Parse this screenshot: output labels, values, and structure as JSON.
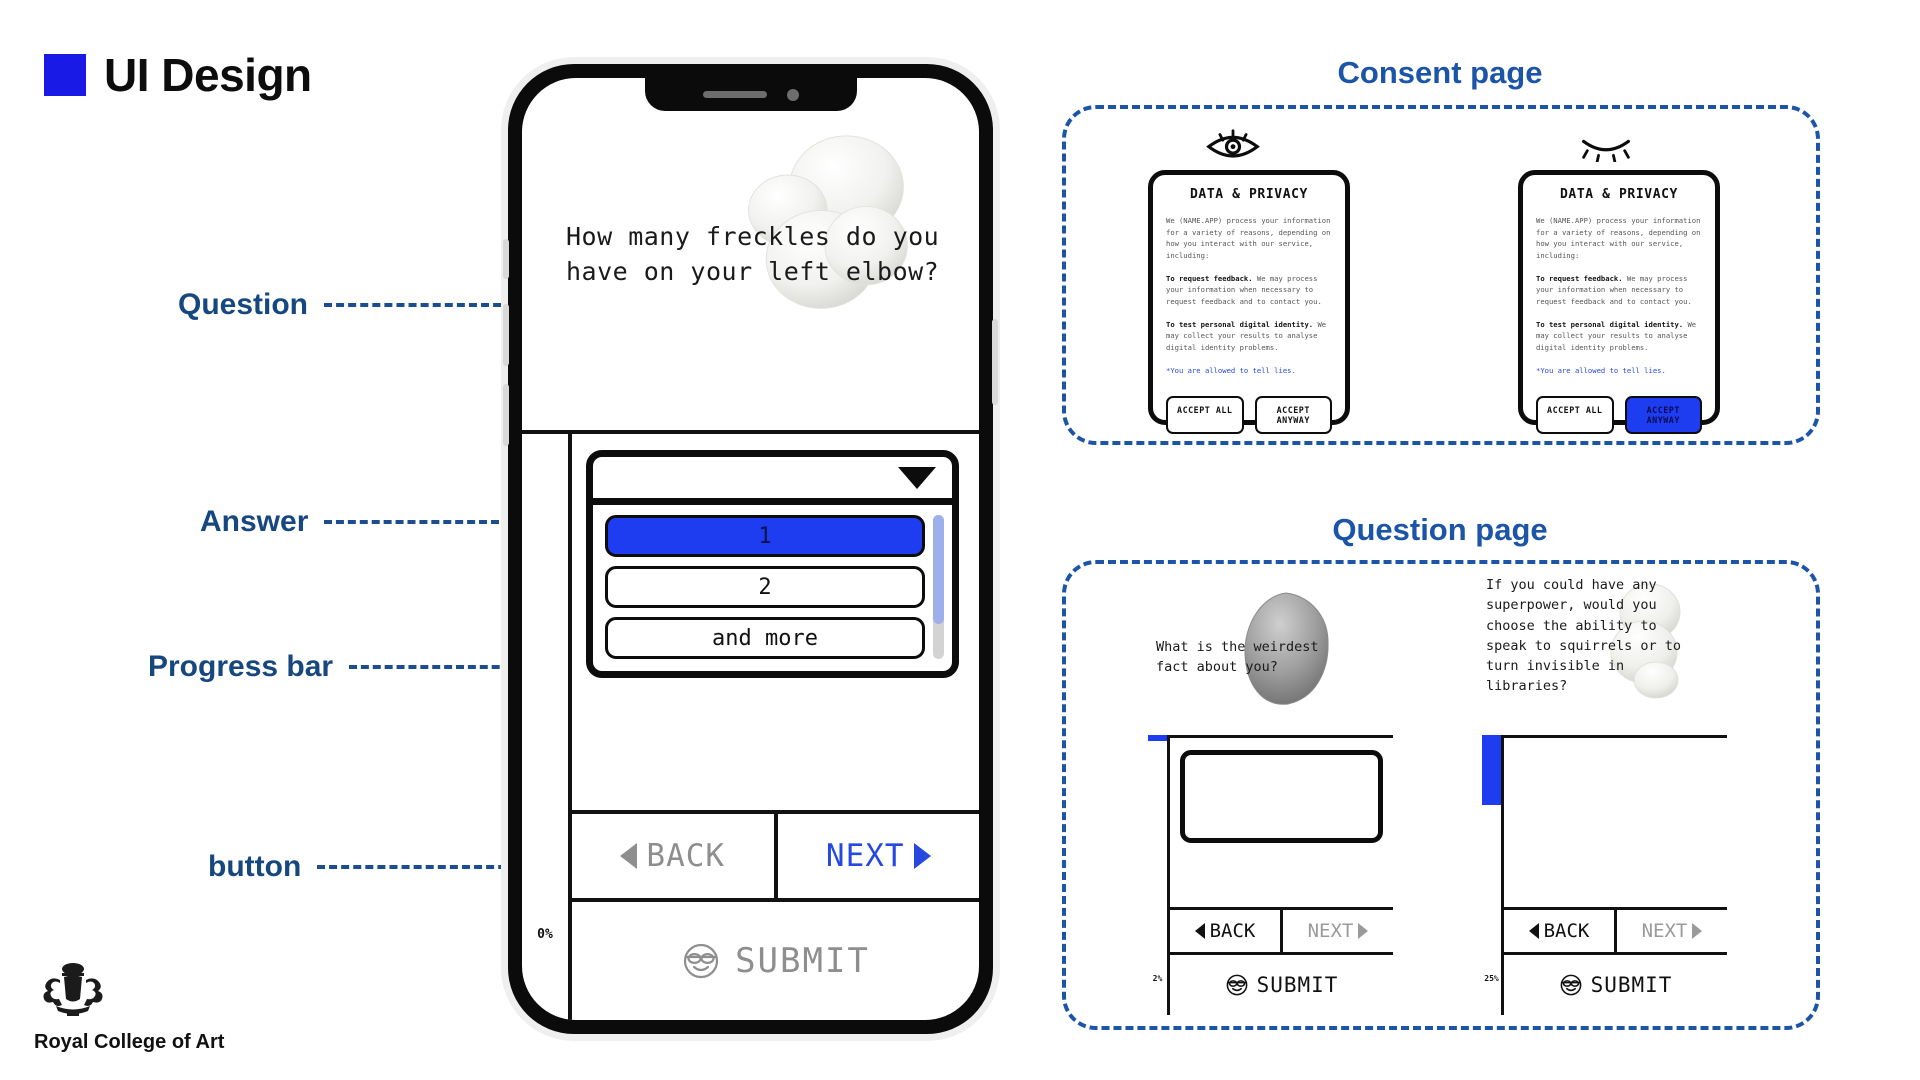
{
  "slide": {
    "title": "UI Design",
    "accent_blue": "#1a1ae6",
    "label_blue": "#16477e",
    "panel_blue": "#1c55a8"
  },
  "annotations": [
    {
      "label": "Question"
    },
    {
      "label": "Answer"
    },
    {
      "label": "Progress bar"
    },
    {
      "label": "button"
    }
  ],
  "phone": {
    "question_text": "How many freckles do you have on your left elbow?",
    "dropdown": {
      "selected": "",
      "options": [
        "1",
        "2",
        "and more"
      ],
      "highlighted_index": 0,
      "caret_icon": "chevron-down-icon"
    },
    "progress": {
      "percent_label": "0%",
      "percent_value": 0
    },
    "nav": {
      "back_label": "BACK",
      "next_label": "NEXT",
      "back_icon": "triangle-left-icon",
      "next_icon": "triangle-right-icon"
    },
    "submit": {
      "label": "SUBMIT",
      "icon": "sunglasses-smiley-icon"
    }
  },
  "consent_panel": {
    "title": "Consent page",
    "cards": [
      {
        "eye_icon": "eye-open-icon",
        "heading": "DATA & PRIVACY",
        "intro": "We (NAME.APP) process your information for a variety of reasons, depending on how you interact with our service, including:",
        "point1_bold": "To request feedback.",
        "point1_rest": " We may process your information when necessary to request feedback and to contact you.",
        "point2_bold": "To test personal digital identity.",
        "point2_rest": " We may collect your results to analyse digital identity problems.",
        "footnote": "*You are allowed to tell lies.",
        "buttons": [
          {
            "label": "ACCEPT ALL",
            "filled": false
          },
          {
            "label": "ACCEPT ANYWAY",
            "filled": false
          }
        ]
      },
      {
        "eye_icon": "eye-closed-icon",
        "heading": "DATA & PRIVACY",
        "intro": "We (NAME.APP) process your information for a variety of reasons, depending on how you interact with our service, including:",
        "point1_bold": "To request feedback.",
        "point1_rest": " We may process your information when necessary to request feedback and to contact you.",
        "point2_bold": "To test personal digital identity.",
        "point2_rest": " We may collect your results to analyse digital identity problems.",
        "footnote": "*You are allowed to tell lies.",
        "buttons": [
          {
            "label": "ACCEPT ALL",
            "filled": false
          },
          {
            "label": "ACCEPT ANYWAY",
            "filled": true
          }
        ]
      }
    ]
  },
  "question_panel": {
    "title": "Question page",
    "screens": [
      {
        "question": "What is the weirdest fact about you?",
        "progress_label": "2%",
        "progress_value": 2,
        "has_input_box": true,
        "back_label": "BACK",
        "next_label": "NEXT",
        "submit_label": "SUBMIT",
        "submit_icon": "sunglasses-smiley-icon"
      },
      {
        "question": "If you could have any superpower, would you choose the ability to speak to squirrels or to turn invisible in libraries?",
        "progress_label": "25%",
        "progress_value": 25,
        "has_input_box": false,
        "back_label": "BACK",
        "next_label": "NEXT",
        "submit_label": "SUBMIT",
        "submit_icon": "sunglasses-smiley-icon"
      }
    ]
  },
  "footer": {
    "logo_text": "Royal College of Art",
    "crest_icon": "royal-crest-icon"
  }
}
